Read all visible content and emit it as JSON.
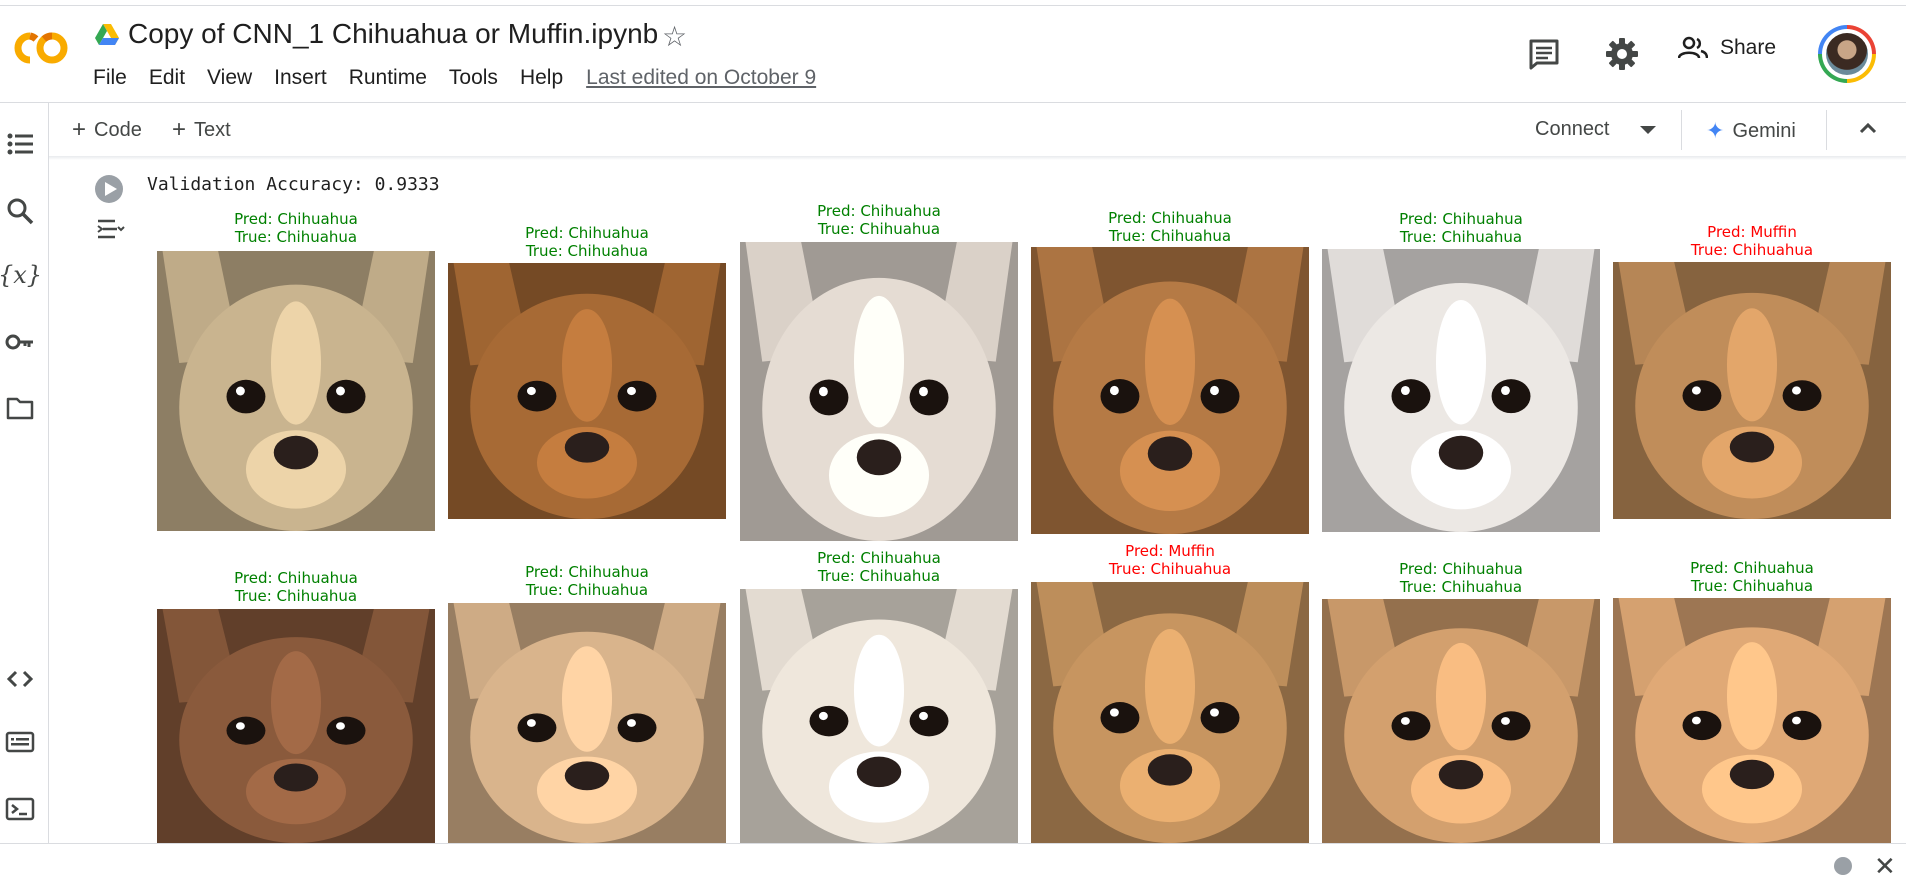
{
  "header": {
    "logo_icon": "colab-logo",
    "drive_icon": "google-drive-icon",
    "title": "Copy of CNN_1 Chihuahua or Muffin.ipynb",
    "star_icon": "star-outline-icon",
    "menu": [
      "File",
      "Edit",
      "View",
      "Insert",
      "Runtime",
      "Tools",
      "Help"
    ],
    "last_edited": "Last edited on October 9",
    "comment_icon": "comment-icon",
    "settings_icon": "gear-icon",
    "share_label": "Share",
    "share_icon": "people-icon",
    "avatar_icon": "user-avatar"
  },
  "toolbar": {
    "add_code": "Code",
    "add_text": "Text",
    "connect": "Connect",
    "gemini": "Gemini"
  },
  "cell": {
    "output_text": "Validation Accuracy: 0.9333"
  },
  "results": [
    {
      "pred": "Pred: Chihuahua",
      "true": "True: Chihuahua",
      "correct": true,
      "tone": "#c9b48f"
    },
    {
      "pred": "Pred: Chihuahua",
      "true": "True: Chihuahua",
      "correct": true,
      "tone": "#a76a35"
    },
    {
      "pred": "Pred: Chihuahua",
      "true": "True: Chihuahua",
      "correct": true,
      "tone": "#e5dcd3"
    },
    {
      "pred": "Pred: Chihuahua",
      "true": "True: Chihuahua",
      "correct": true,
      "tone": "#b57a45"
    },
    {
      "pred": "Pred: Chihuahua",
      "true": "True: Chihuahua",
      "correct": true,
      "tone": "#ece8e4"
    },
    {
      "pred": "Pred: Muffin",
      "true": "True: Chihuahua",
      "correct": false,
      "tone": "#c08d5a"
    },
    {
      "pred": "Pred: Chihuahua",
      "true": "True: Chihuahua",
      "correct": true,
      "tone": "#8a5a3c"
    },
    {
      "pred": "Pred: Chihuahua",
      "true": "True: Chihuahua",
      "correct": true,
      "tone": "#d9b48c"
    },
    {
      "pred": "Pred: Chihuahua",
      "true": "True: Chihuahua",
      "correct": true,
      "tone": "#efe7dc"
    },
    {
      "pred": "Pred: Muffin",
      "true": "True: Chihuahua",
      "correct": false,
      "tone": "#c79560"
    },
    {
      "pred": "Pred: Chihuahua",
      "true": "True: Chihuahua",
      "correct": true,
      "tone": "#d3a06e"
    },
    {
      "pred": "Pred: Chihuahua",
      "true": "True: Chihuahua",
      "correct": true,
      "tone": "#e0a976"
    }
  ],
  "colors": {
    "correct": "#008000",
    "incorrect": "#ff0000",
    "accent": "#4285f4"
  }
}
